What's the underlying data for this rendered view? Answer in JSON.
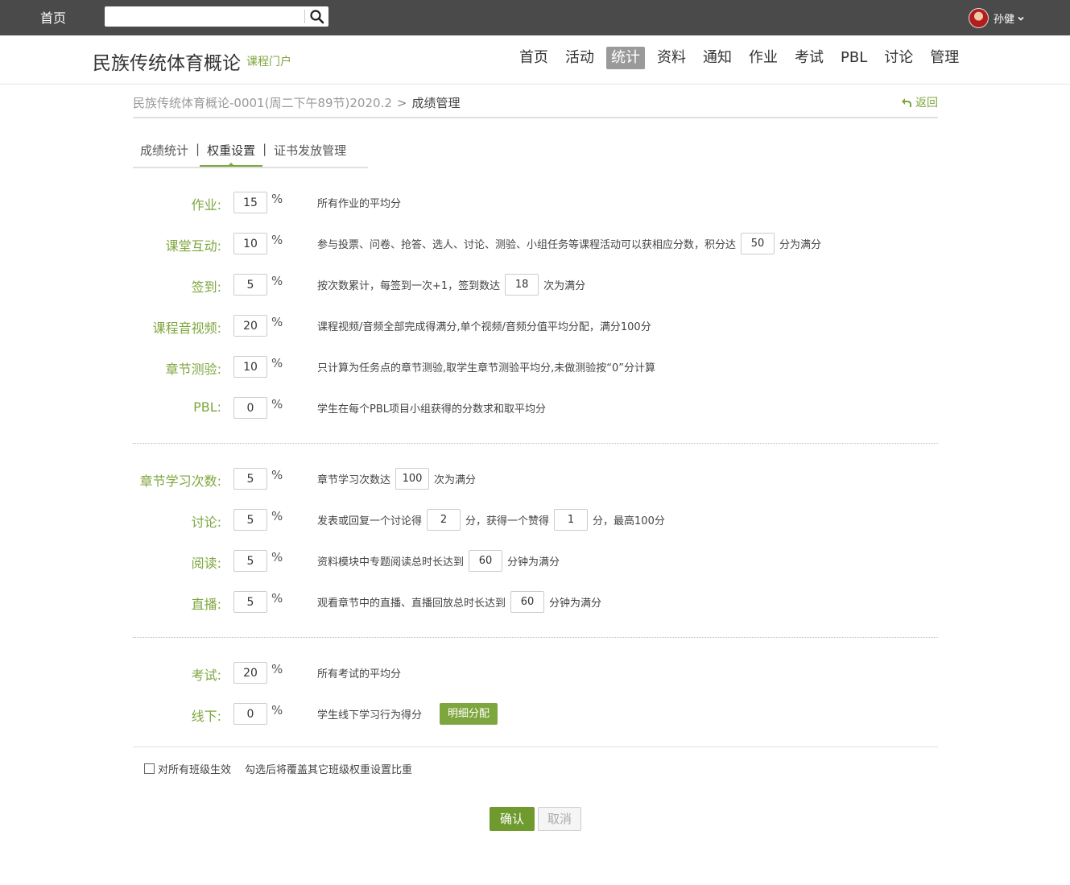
{
  "topbar": {
    "home": "首页",
    "search_value": "",
    "user_name": "孙健"
  },
  "header": {
    "course_title": "民族传统体育概论",
    "portal": "课程门户",
    "nav": [
      "首页",
      "活动",
      "统计",
      "资料",
      "通知",
      "作业",
      "考试",
      "PBL",
      "讨论",
      "管理"
    ],
    "nav_active": "统计"
  },
  "breadcrumb": {
    "parent": "民族传统体育概论-0001(周二下午89节)2020.2",
    "separator": ">",
    "current": "成绩管理",
    "back": "返回"
  },
  "tabs": {
    "items": [
      "成绩统计",
      "权重设置",
      "证书发放管理"
    ],
    "separator": "|",
    "active": "权重设置"
  },
  "pct_sign": "%",
  "rows": {
    "homework": {
      "label": "作业:",
      "value": "15",
      "desc": "所有作业的平均分"
    },
    "interaction": {
      "label": "课堂互动:",
      "value": "10",
      "desc1": "参与投票、问卷、抢答、选人、讨论、测验、小组任务等课程活动可以获相应分数，积分达",
      "inl1": "50",
      "desc2": "分为满分"
    },
    "signin": {
      "label": "签到:",
      "value": "5",
      "desc1": "按次数累计，每签到一次+1，签到数达",
      "inl1": "18",
      "desc2": "次为满分"
    },
    "video": {
      "label": "课程音视频:",
      "value": "20",
      "desc": "课程视频/音频全部完成得满分,单个视频/音频分值平均分配，满分100分"
    },
    "quiz": {
      "label": "章节测验:",
      "value": "10",
      "desc": "只计算为任务点的章节测验,取学生章节测验平均分,未做测验按“0”分计算"
    },
    "pbl": {
      "label": "PBL:",
      "value": "0",
      "desc": "学生在每个PBL项目小组获得的分数求和取平均分"
    },
    "chapter": {
      "label": "章节学习次数:",
      "value": "5",
      "desc1": "章节学习次数达",
      "inl1": "100",
      "desc2": "次为满分"
    },
    "discuss": {
      "label": "讨论:",
      "value": "5",
      "desc1": "发表或回复一个讨论得",
      "inl1": "2",
      "desc2": "分，获得一个赞得",
      "inl2": "1",
      "desc3": "分，最高100分"
    },
    "reading": {
      "label": "阅读:",
      "value": "5",
      "desc1": "资料模块中专题阅读总时长达到",
      "inl1": "60",
      "desc2": "分钟为满分"
    },
    "live": {
      "label": "直播:",
      "value": "5",
      "desc1": "观看章节中的直播、直播回放总时长达到",
      "inl1": "60",
      "desc2": "分钟为满分"
    },
    "exam": {
      "label": "考试:",
      "value": "20",
      "desc": "所有考试的平均分"
    },
    "offline": {
      "label": "线下:",
      "value": "0",
      "desc": "学生线下学习行为得分",
      "button": "明细分配"
    }
  },
  "apply_all": {
    "checked": false,
    "label": "对所有班级生效",
    "note": "勾选后将覆盖其它班级权重设置比重"
  },
  "actions": {
    "confirm": "确认",
    "cancel": "取消"
  },
  "colors": {
    "accent": "#7ea63e",
    "topbar": "#4a4a4a",
    "confirm": "#6e9a2e"
  }
}
